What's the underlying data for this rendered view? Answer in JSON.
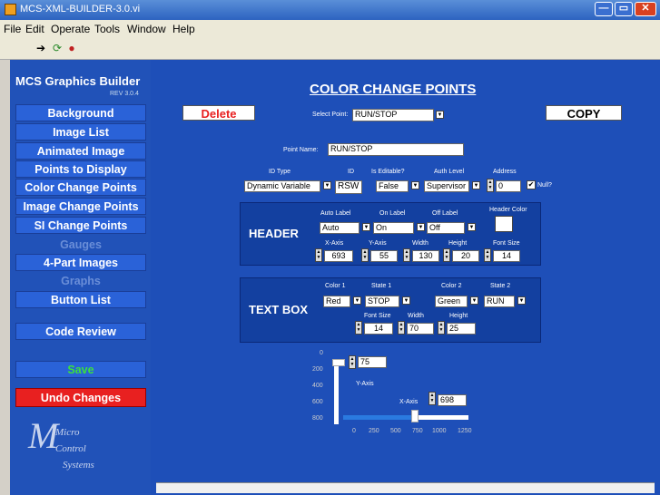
{
  "window": {
    "title": "MCS-XML-BUILDER-3.0.vi",
    "min": "—",
    "max": "▭",
    "close": "✕"
  },
  "menu": [
    "File",
    "Edit",
    "Operate",
    "Tools",
    "Window",
    "Help"
  ],
  "toolbar": {
    "run": "➔",
    "run_cont": "⟳",
    "abort": "●"
  },
  "sidebar": {
    "title": "MCS Graphics Builder",
    "rev": "REV 3.0.4",
    "items": [
      "Background",
      "Image List",
      "Animated Image",
      "Points to Display",
      "Color Change Points",
      "Image Change Points",
      "SI Change Points",
      "Gauges",
      "4-Part Images",
      "Graphs",
      "Button List"
    ],
    "code_review": "Code Review",
    "save": "Save",
    "undo": "Undo Changes",
    "logo": [
      "Micro",
      "Control",
      "Systems"
    ]
  },
  "main": {
    "title": "COLOR CHANGE POINTS",
    "delete": "Delete",
    "copy": "COPY",
    "select_label": "Select Point:",
    "select_value": "RUN/STOP",
    "point_name_label": "Point Name:",
    "point_name": "RUN/STOP",
    "id_type_label": "ID Type",
    "id_type": "Dynamic Variable",
    "id_label": "ID",
    "id": "RSW",
    "editable_label": "Is Editable?",
    "editable": "False",
    "auth_label": "Auth Level",
    "auth": "Supervisor",
    "address_label": "Address",
    "address": "0",
    "null_label": "Null?",
    "header": {
      "title": "HEADER",
      "auto_label": "Auto Label",
      "auto": "Auto",
      "on_label": "On Label",
      "on": "On",
      "off_label": "Off Label",
      "off": "Off",
      "color_label": "Header Color",
      "xaxis_label": "X-Axis",
      "xaxis": "693",
      "yaxis_label": "Y-Axis",
      "yaxis": "55",
      "width_label": "Width",
      "width": "130",
      "height_label": "Height",
      "height": "20",
      "font_label": "Font Size",
      "font": "14"
    },
    "textbox": {
      "title": "TEXT BOX",
      "color1_label": "Color 1",
      "color1": "Red",
      "state1_label": "State 1",
      "state1": "STOP",
      "color2_label": "Color 2",
      "color2": "Green",
      "state2_label": "State 2",
      "state2": "RUN",
      "font_label": "Font Size",
      "font": "14",
      "width_label": "Width",
      "width": "70",
      "height_label": "Height",
      "height": "25"
    },
    "pos": {
      "y_ticks": [
        "0",
        "200",
        "400",
        "600",
        "800"
      ],
      "y_value": "75",
      "y_label": "Y-Axis",
      "x_label": "X-Axis",
      "x_value": "698",
      "x_ticks": [
        "0",
        "250",
        "500",
        "750",
        "1000",
        "1250"
      ]
    }
  },
  "colors": {
    "red": "#e82020",
    "green": "#20a020",
    "blue": "#1e4fb8"
  }
}
